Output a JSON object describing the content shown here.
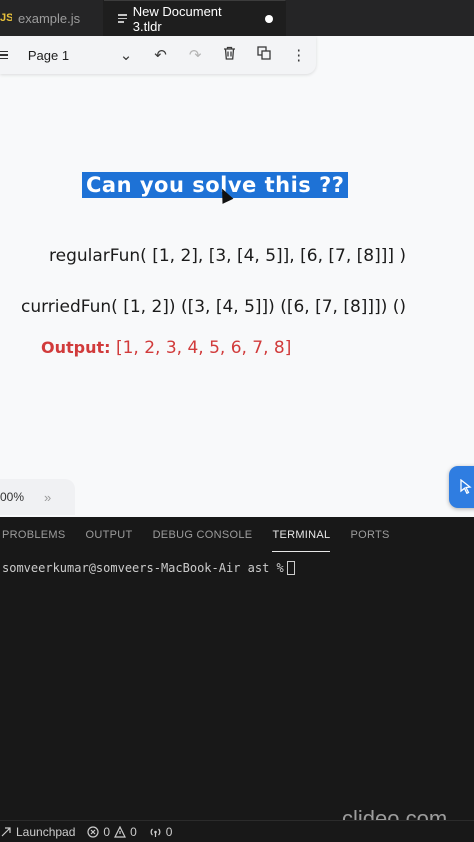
{
  "tabs": [
    {
      "label": "example.js",
      "badge": "JS",
      "active": false
    },
    {
      "label": "New Document 3.tldr",
      "active": true,
      "dirty": true
    }
  ],
  "toolbar": {
    "page_label": "Page 1",
    "undo_icon": "↶",
    "redo_icon": "↷",
    "trash_icon": "🗑",
    "duplicate_icon": "⧉",
    "more_icon": "⋮",
    "chevron_icon": "⌄"
  },
  "slide": {
    "title": "Can you solve this ??",
    "regular": "regularFun( [1, 2], [3, [4, 5]], [6, [7, [8]]] )",
    "curried": "curriedFun( [1, 2]) ([3, [4, 5]]) ([6, [7, [8]]]) ()",
    "output_label": "Output:",
    "output_value": "[1, 2, 3, 4, 5, 6, 7, 8]"
  },
  "zoom": {
    "value": "00%",
    "chevron": "»"
  },
  "panel": {
    "tabs": [
      "PROBLEMS",
      "OUTPUT",
      "DEBUG CONSOLE",
      "TERMINAL",
      "PORTS"
    ],
    "active_tab": "TERMINAL",
    "terminal_prompt": "somveerkumar@somveers-MacBook-Air ast %"
  },
  "statusbar": {
    "launchpad": "Launchpad",
    "errors": "0",
    "warnings": "0",
    "ports": "0"
  },
  "watermark": "clideo.com",
  "colors": {
    "accent": "#1e72d6",
    "output_red": "#d13b3b",
    "button_blue": "#2f7de1"
  }
}
